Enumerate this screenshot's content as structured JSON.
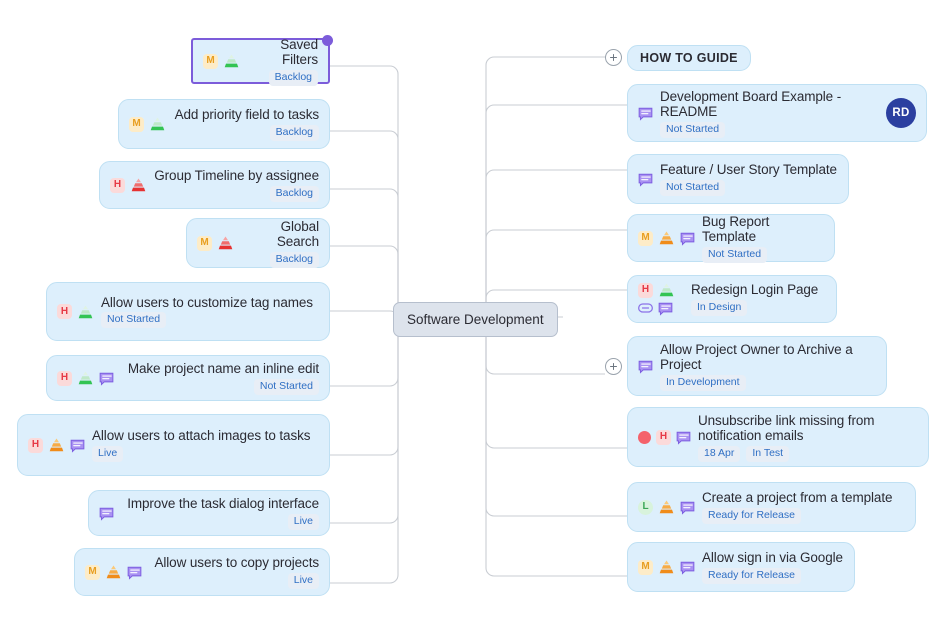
{
  "center": {
    "label": "Software Development"
  },
  "colors": {
    "node_fill": "#ddeffc",
    "node_border": "#bfe0f3",
    "center_fill": "#dde3ec",
    "selection": "#7c5cda",
    "chip_text": "#2f6fc4",
    "priority_high": "#e63946",
    "priority_medium": "#e89e20",
    "priority_low": "#3aa655",
    "avatar_bg": "#2b3fa0",
    "bug_dot": "#f4626b",
    "comment_icon": "#8b72e8",
    "link_icon": "#8b72e8"
  },
  "guide": {
    "label": "HOW TO GUIDE",
    "expand_icon": "plus-circle-icon"
  },
  "left_nodes": [
    {
      "title": "Saved Filters",
      "chips": [
        "Backlog"
      ],
      "icons": [
        "priority-medium-icon",
        "effort-low-cone-icon"
      ],
      "priority": "M",
      "cone": "green",
      "selected": true
    },
    {
      "title": "Add priority field to tasks",
      "chips": [
        "Backlog"
      ],
      "icons": [
        "priority-medium-icon",
        "effort-low-cone-icon"
      ],
      "priority": "M",
      "cone": "green",
      "selected": false
    },
    {
      "title": "Group Timeline by assignee",
      "chips": [
        "Backlog"
      ],
      "icons": [
        "priority-high-icon",
        "effort-high-cone-icon"
      ],
      "priority": "H",
      "cone": "red",
      "selected": false
    },
    {
      "title": "Global Search",
      "chips": [
        "Backlog"
      ],
      "icons": [
        "priority-medium-icon",
        "effort-high-cone-icon"
      ],
      "priority": "M",
      "cone": "red",
      "selected": false
    },
    {
      "title": "Allow users to customize tag names",
      "chips": [
        "Not Started"
      ],
      "icons": [
        "priority-high-icon",
        "effort-low-cone-icon"
      ],
      "priority": "H",
      "cone": "green",
      "selected": false
    },
    {
      "title": "Make project name an inline edit",
      "chips": [
        "Not Started"
      ],
      "icons": [
        "priority-high-icon",
        "effort-low-cone-icon",
        "comment-icon"
      ],
      "priority": "H",
      "cone": "green",
      "comment": true,
      "selected": false
    },
    {
      "title": "Allow users to attach images to tasks",
      "chips": [
        "Live"
      ],
      "icons": [
        "priority-high-icon",
        "effort-medium-cone-icon",
        "comment-icon"
      ],
      "priority": "H",
      "cone": "orange",
      "comment": true,
      "selected": false
    },
    {
      "title": "Improve the task dialog interface",
      "chips": [
        "Live"
      ],
      "icons": [
        "comment-icon"
      ],
      "comment": true,
      "selected": false
    },
    {
      "title": "Allow users to copy projects",
      "chips": [
        "Live"
      ],
      "icons": [
        "priority-medium-icon",
        "effort-medium-cone-icon",
        "comment-icon"
      ],
      "priority": "M",
      "cone": "orange",
      "comment": true,
      "selected": false
    }
  ],
  "right_nodes": [
    {
      "title": "Development Board Example - README",
      "chips": [
        "Not Started"
      ],
      "icons": [
        "comment-icon",
        "avatar"
      ],
      "comment": true,
      "avatar": "RD",
      "expandable": false
    },
    {
      "title": "Feature / User Story Template",
      "chips": [
        "Not Started"
      ],
      "icons": [
        "comment-icon"
      ],
      "comment": true,
      "expandable": false
    },
    {
      "title": "Bug Report Template",
      "chips": [
        "Not Started"
      ],
      "icons": [
        "priority-medium-icon",
        "effort-medium-cone-icon",
        "comment-icon"
      ],
      "priority": "M",
      "cone": "orange",
      "comment": true,
      "expandable": false
    },
    {
      "title": "Redesign Login Page",
      "chips": [
        "In Design"
      ],
      "icons": [
        "priority-high-icon",
        "effort-low-cone-icon",
        "link-icon",
        "comment-icon"
      ],
      "priority": "H",
      "cone": "green",
      "comment": true,
      "link": true,
      "expandable": false
    },
    {
      "title": "Allow Project Owner to Archive a Project",
      "chips": [
        "In Development"
      ],
      "icons": [
        "comment-icon"
      ],
      "comment": true,
      "expandable": true
    },
    {
      "title": "Unsubscribe link missing from notification emails",
      "chips": [
        "18 Apr",
        "In Test"
      ],
      "icons": [
        "bug-dot-icon",
        "priority-high-icon",
        "comment-icon"
      ],
      "priority": "H",
      "bug": true,
      "comment": true,
      "expandable": false
    },
    {
      "title": "Create a project from a template",
      "chips": [
        "Ready for Release"
      ],
      "icons": [
        "priority-low-icon",
        "effort-medium-cone-icon",
        "comment-icon"
      ],
      "priority": "L",
      "cone": "orange",
      "comment": true,
      "expandable": false
    },
    {
      "title": "Allow sign in via Google",
      "chips": [
        "Ready for Release"
      ],
      "icons": [
        "priority-medium-icon",
        "effort-medium-cone-icon",
        "comment-icon"
      ],
      "priority": "M",
      "cone": "orange",
      "comment": true,
      "expandable": false
    }
  ]
}
